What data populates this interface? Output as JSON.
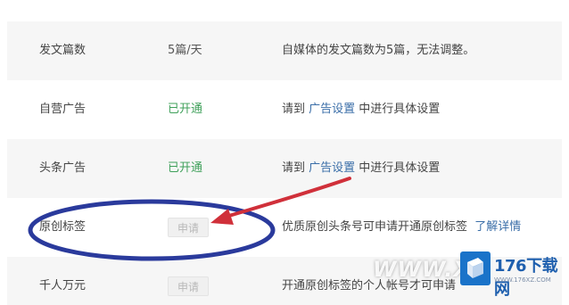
{
  "rows": [
    {
      "name": "发文篇数",
      "status": "5篇/天",
      "desc": "自媒体的发文篇数为5篇，无法调整。"
    },
    {
      "name": "自营广告",
      "status": "已开通",
      "desc_pre": "请到 ",
      "desc_link": "广告设置",
      "desc_post": " 中进行具体设置"
    },
    {
      "name": "头条广告",
      "status": "已开通",
      "desc_pre": "请到 ",
      "desc_link": "广告设置",
      "desc_post": " 中进行具体设置"
    },
    {
      "name": "原创标签",
      "button": "申请",
      "desc": "优质原创头条号可申请开通原创标签",
      "desc_link": "了解详情"
    },
    {
      "name": "千人万元",
      "button": "申请",
      "desc": "开通原创标签的个人帐号才可申请"
    }
  ],
  "watermark": {
    "xf": "WWW.XF",
    "logo_text": "176下载网",
    "logo_sub": "WWW.176XZ.COM"
  },
  "colors": {
    "annotation": "#2a3a9c",
    "arrow": "#d0303a",
    "open_status": "#3fa05a"
  }
}
